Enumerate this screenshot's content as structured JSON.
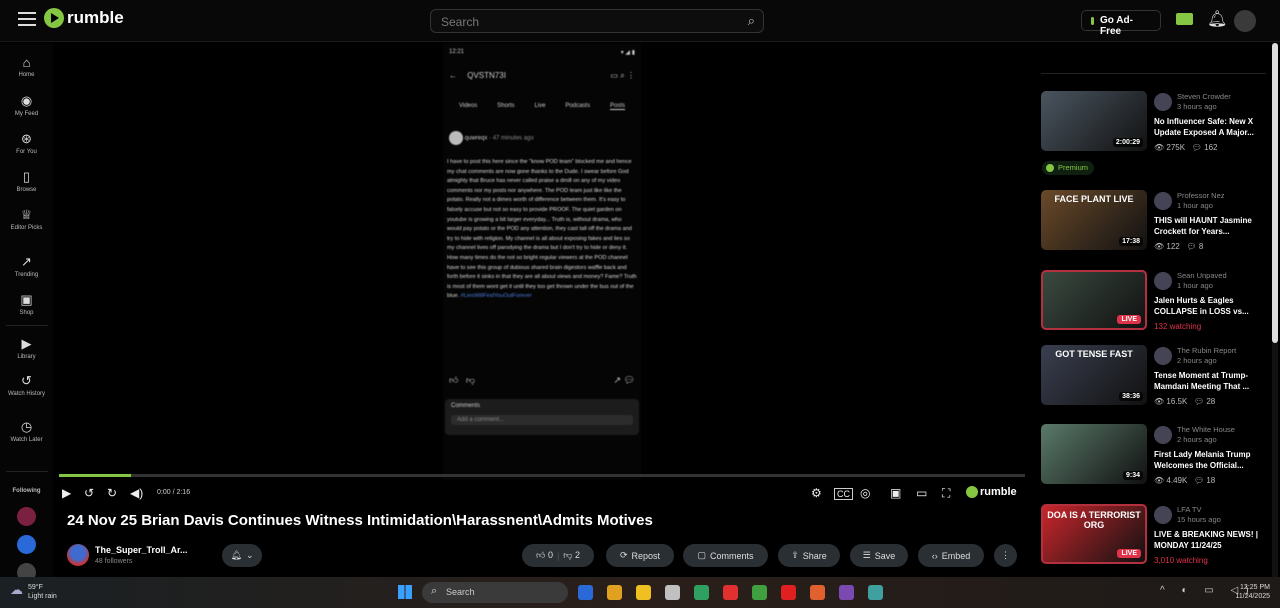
{
  "header": {
    "brand": "rumble",
    "search_placeholder": "Search",
    "go_ad_free": "Go Ad-Free"
  },
  "sidebar": {
    "items": [
      {
        "label": "Home",
        "icon": "⌂"
      },
      {
        "label": "My Feed",
        "icon": "◉"
      },
      {
        "label": "For You",
        "icon": "⊛"
      },
      {
        "label": "Browse",
        "icon": "▯"
      },
      {
        "label": "Editor Picks",
        "icon": "♕"
      },
      {
        "label": "Trending",
        "icon": "↗"
      },
      {
        "label": "Shop",
        "icon": "▣"
      },
      {
        "label": "Library",
        "icon": "▶"
      },
      {
        "label": "Watch History",
        "icon": "↺"
      },
      {
        "label": "Watch Later",
        "icon": "◷"
      }
    ],
    "following_label": "Following"
  },
  "phone": {
    "status_time": "12:21",
    "channel": "QVSTN73I",
    "tabs": [
      "Videos",
      "Shorts",
      "Live",
      "Podcasts",
      "Posts"
    ],
    "post_author": "quwreqx",
    "post_time": "47 minutes ago",
    "post_text": "I have to post this here since the \"know POD team\" blocked me and hence my chat comments are now gone thanks to the Dude. I swear before God almighty that Bruce has never called praise a dmill on any of my video comments nor my posts nor anywhere. The POD team just like like the potato. Really not a dimes worth of difference between them. It's easy to falsely accuse but not so easy to provide PROOF. The quiet garden on youtube is growing a bit larger everyday... Truth is, without drama, who would pay potato or the POD any attention, they cast tall off the drama and try to hide with religion. My channel is all about exposing fakes and lies so my channel lives off parodying the drama but I don't try to hide or deny it. How many times do the not so bright regular viewers at the POD channel have to see this group of dubious shared brain digestors waffle back and forth before it sinks in that they are all about views and money? Fame? Truth is most of them wont get it until they too get thrown under the bus out of the blue.",
    "post_tag": "#LiesWillFindYouOutForever",
    "comments_label": "Comments",
    "add_comment": "Add a comment..."
  },
  "player": {
    "time": "0:00 / 2:16",
    "progress": 0.075,
    "brand": "rumble"
  },
  "video": {
    "title": "24 Nov 25 Brian Davis Continues Witness Intimidation\\Harassnent\\Admits Motives",
    "channel": "The_Super_Troll_Ar...",
    "followers": "48 followers",
    "likes": "0",
    "dislikes": "2",
    "actions": [
      "Repost",
      "Comments",
      "Share",
      "Save",
      "Embed"
    ]
  },
  "premium_label": "Premium",
  "recommended": [
    {
      "channel": "Steven Crowder",
      "age": "3 hours ago",
      "title": "No Influencer Safe: New X Update Exposed A Major...",
      "duration": "2:00:29",
      "views": "275K",
      "comments": "162",
      "live": false,
      "thumb": "#4a5560"
    },
    {
      "channel": "Professor Nez",
      "age": "1 hour ago",
      "title": "THIS will HAUNT Jasmine Crockett for Years...",
      "duration": "17:38",
      "views": "122",
      "comments": "8",
      "live": false,
      "thumb": "#6a4a2a",
      "thumb_text": "FACE PLANT LIVE"
    },
    {
      "channel": "Sean Unpaved",
      "age": "1 hour ago",
      "title": "Jalen Hurts & Eagles COLLAPSE in LOSS vs...",
      "live": true,
      "live_label": "LIVE",
      "watching": "132 watching",
      "thumb": "#3a4a40"
    },
    {
      "channel": "The Rubin Report",
      "age": "2 hours ago",
      "title": "Tense Moment at Trump-Mamdani Meeting That ...",
      "duration": "38:36",
      "views": "16.5K",
      "comments": "28",
      "live": false,
      "thumb": "#3a3f50",
      "thumb_text": "GOT TENSE FAST"
    },
    {
      "channel": "The White House",
      "age": "2 hours ago",
      "title": "First Lady Melania Trump Welcomes the Official...",
      "duration": "9:34",
      "views": "4.49K",
      "comments": "18",
      "live": false,
      "thumb": "#5a7a6a"
    },
    {
      "channel": "LFA TV",
      "age": "15 hours ago",
      "title": "LIVE & BREAKING NEWS! | MONDAY 11/24/25",
      "live": true,
      "live_label": "LIVE",
      "watching": "3,010 watching",
      "thumb": "#c8262c",
      "thumb_text": "DOA IS A TERRORIST ORG"
    }
  ],
  "taskbar": {
    "temp": "59°F",
    "weather": "Light rain",
    "search": "Search",
    "time": "12:25 PM",
    "date": "11/24/2025"
  }
}
